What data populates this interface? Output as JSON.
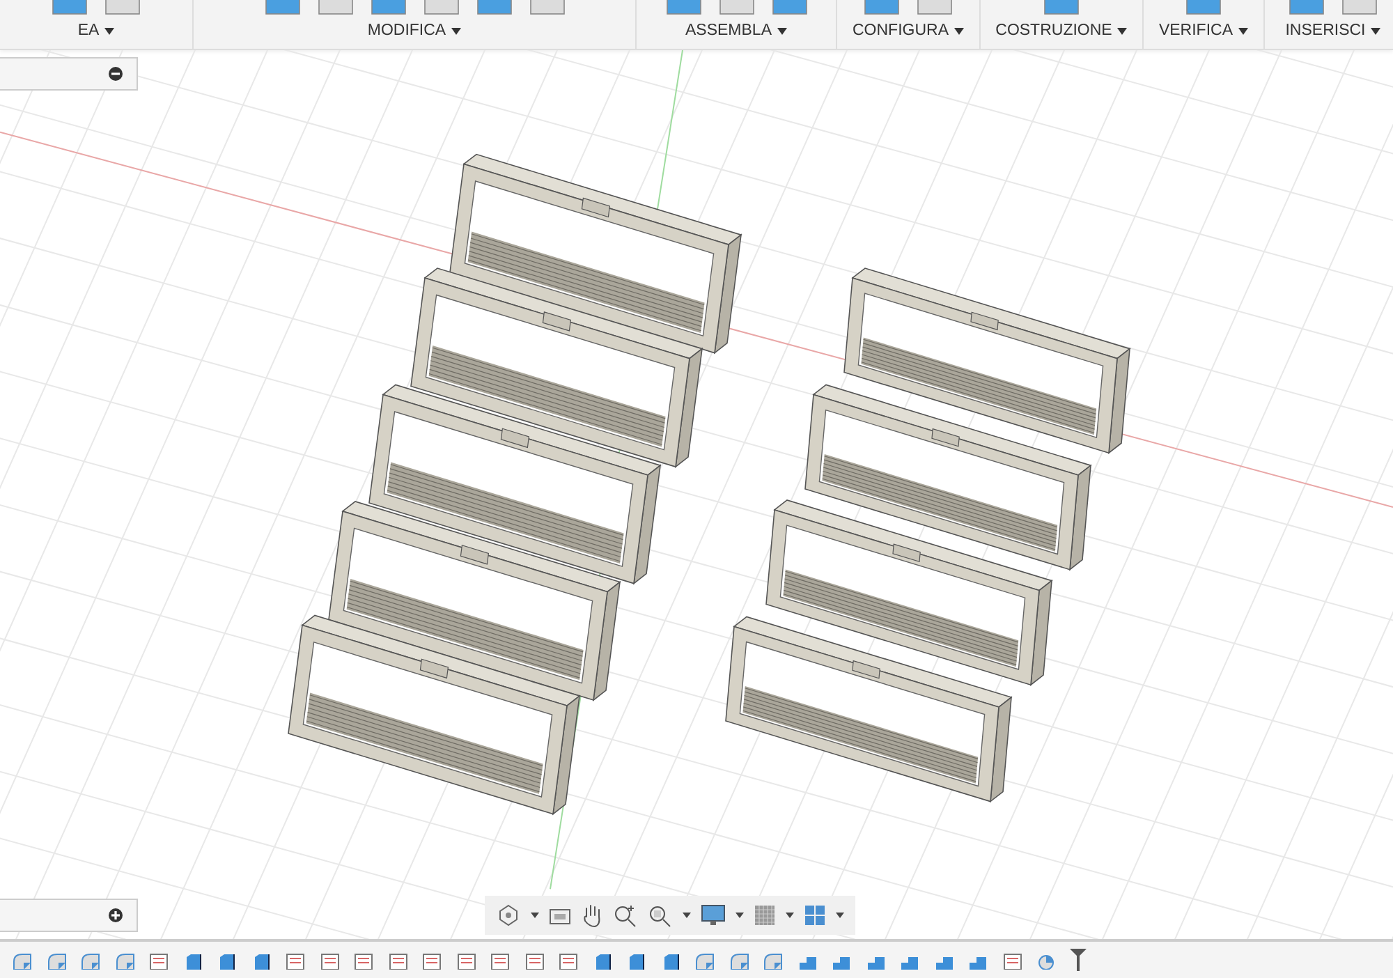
{
  "toolbar": {
    "groups": [
      {
        "label": "EA"
      },
      {
        "label": "MODIFICA"
      },
      {
        "label": "ASSEMBLA"
      },
      {
        "label": "CONFIGURA"
      },
      {
        "label": "COSTRUZIONE"
      },
      {
        "label": "VERIFICA"
      },
      {
        "label": "INSERISCI"
      }
    ]
  }
}
